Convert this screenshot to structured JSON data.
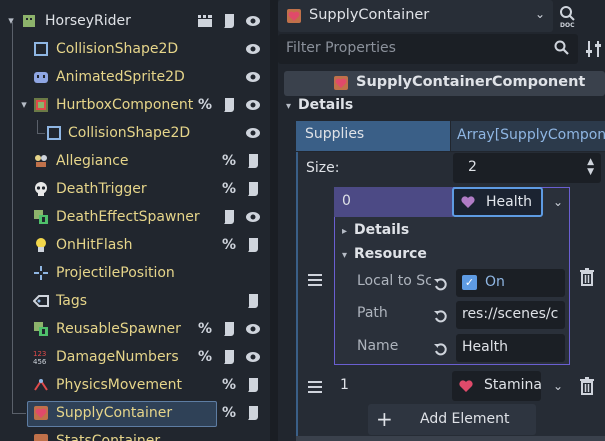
{
  "scene_tree": {
    "nodes": [
      {
        "label": "HorseyRider",
        "icon": "character-body-icon",
        "root": true
      },
      {
        "label": "CollisionShape2D",
        "icon": "collision-shape-icon"
      },
      {
        "label": "AnimatedSprite2D",
        "icon": "animated-sprite-icon"
      },
      {
        "label": "HurtboxComponent",
        "icon": "hurtbox-icon"
      },
      {
        "label": "CollisionShape2D",
        "icon": "collision-shape-icon"
      },
      {
        "label": "Allegiance",
        "icon": "allegiance-icon"
      },
      {
        "label": "DeathTrigger",
        "icon": "skull-icon"
      },
      {
        "label": "DeathEffectSpawner",
        "icon": "spawner-icon"
      },
      {
        "label": "OnHitFlash",
        "icon": "lightbulb-icon"
      },
      {
        "label": "ProjectilePosition",
        "icon": "marker-icon"
      },
      {
        "label": "Tags",
        "icon": "tag-icon"
      },
      {
        "label": "ReusableSpawner",
        "icon": "spawner-icon"
      },
      {
        "label": "DamageNumbers",
        "icon": "numbers-icon"
      },
      {
        "label": "PhysicsMovement",
        "icon": "movement-icon"
      },
      {
        "label": "SupplyContainer",
        "icon": "supply-heart-icon"
      },
      {
        "label": "StatsContainer",
        "icon": "stats-icon"
      }
    ]
  },
  "inspector": {
    "object_selector": "SupplyContainer",
    "filter_placeholder": "Filter Properties",
    "component_header": "SupplyContainerComponent",
    "section_details": "Details",
    "property_name": "Supplies",
    "property_type": "Array[SupplyCompon",
    "size_label": "Size:",
    "size_value": "2",
    "items": [
      {
        "index": "0",
        "resource": "Health",
        "sub_details": "Details",
        "sub_resource": "Resource",
        "local_label": "Local to Sc",
        "local_value": "On",
        "path_label": "Path",
        "path_value": "res://scenes/c",
        "name_label": "Name",
        "name_value": "Health"
      },
      {
        "index": "1",
        "resource": "Stamina"
      }
    ],
    "add_element": "Add Element"
  },
  "colors": {
    "node_label": "#e6d58a",
    "selection": "#2f4157",
    "accent": "#5e9be3",
    "array_header": "#3a5f87",
    "item_index": "#4c4a85"
  }
}
